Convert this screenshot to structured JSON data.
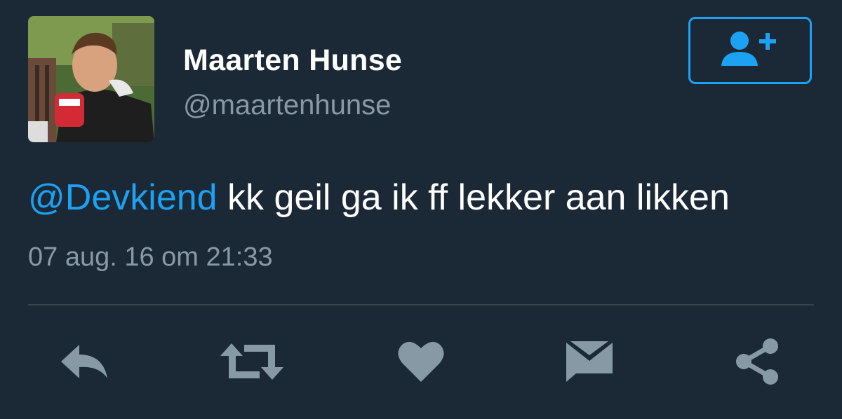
{
  "user": {
    "name": "Maarten Hunse",
    "handle": "@maartenhunse"
  },
  "tweet": {
    "mention": "@Devkiend",
    "text": " kk geil ga ik ff lekker aan likken",
    "timestamp": "07 aug. 16 om 21:33"
  },
  "icons": {
    "follow": "add-user-icon",
    "reply": "reply-icon",
    "retweet": "retweet-icon",
    "like": "heart-icon",
    "message": "envelope-icon",
    "share": "share-icon"
  },
  "colors": {
    "background": "#1b2836",
    "accent": "#1da1f2",
    "muted": "#8899a6",
    "icon": "#8899a6"
  }
}
